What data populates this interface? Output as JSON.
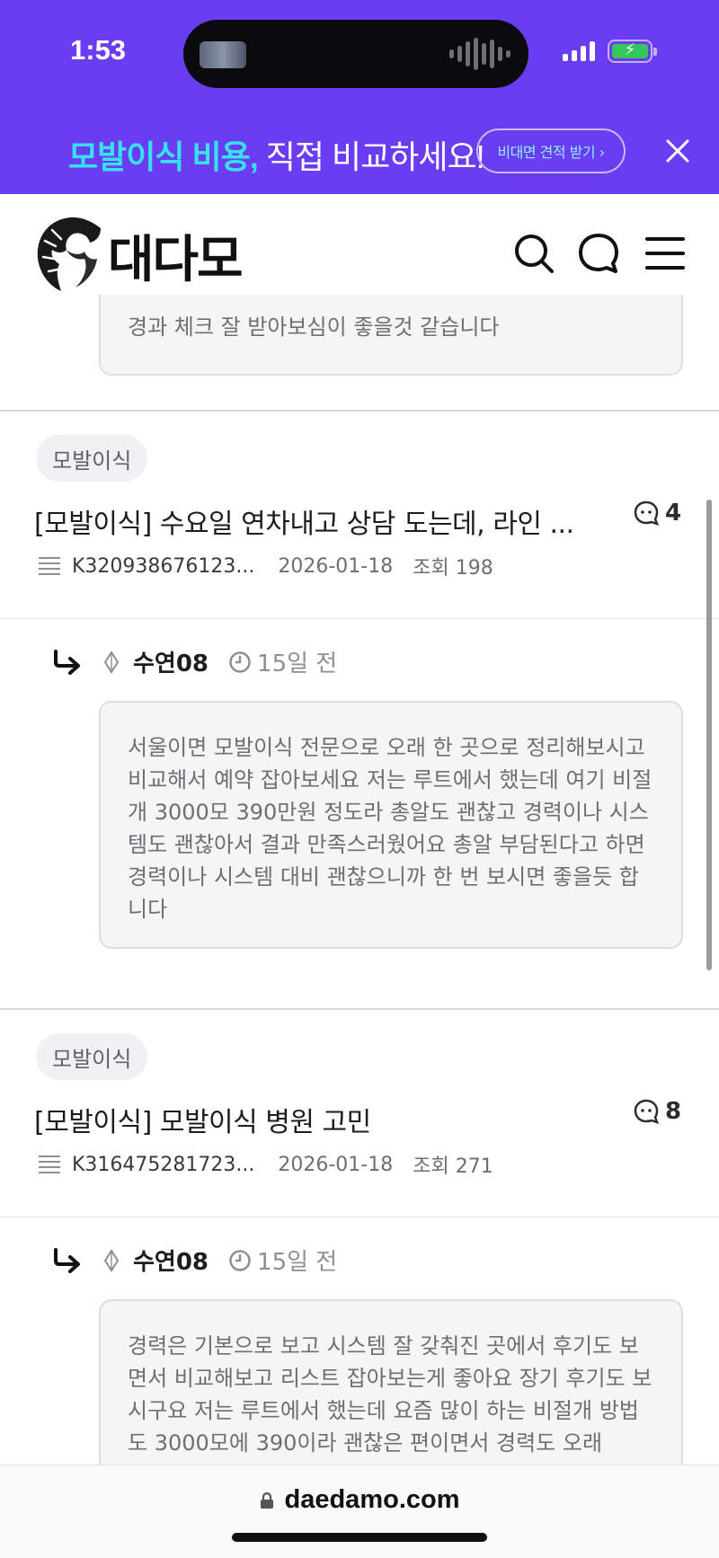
{
  "status_bar": {
    "time": "1:53"
  },
  "ad_banner": {
    "highlight": "모발이식 비용,",
    "rest": " 직접 비교하세요!",
    "button_label": "비대면 견적 받기 ›"
  },
  "header": {
    "logo_text": "대다모"
  },
  "prev_reply_tail": "경과 체크 잘 받아보심이 좋을것 같습니다",
  "posts": [
    {
      "tag": "모발이식",
      "title": "[모발이식] 수요일 연차내고 상담 도는데, 라인 ...",
      "author": "K320938676123...",
      "date": "2026-01-18",
      "views": "조회 198",
      "comment_count": "4",
      "reply": {
        "nickname": "수연08",
        "time_ago": "15일 전",
        "body": "서울이면 모발이식 전문으로 오래 한 곳으로 정리해보시고 비교해서 예약 잡아보세요 저는 루트에서 했는데 여기 비절개 3000모 390만원 정도라 총알도 괜찮고 경력이나 시스템도 괜찮아서 결과 만족스러웠어요 총알 부담된다고 하면 경력이나 시스템 대비 괜찮으니까 한 번 보시면 좋을듯 합니다"
      }
    },
    {
      "tag": "모발이식",
      "title": "[모발이식] 모발이식 병원 고민",
      "author": "K316475281723...",
      "date": "2026-01-18",
      "views": "조회 271",
      "comment_count": "8",
      "reply": {
        "nickname": "수연08",
        "time_ago": "15일 전",
        "body": "경력은 기본으로 보고 시스템 잘 갖춰진 곳에서 후기도 보면서 비교해보고 리스트 잡아보는게 좋아요 장기 후기도 보시구요 저는 루트에서 했는데 요즘 많이 하는 비절개 방법도 3000모에 390이라 괜찮은 편이면서 경력도 오래"
      }
    }
  ],
  "url_bar": {
    "domain": "daedamo.com"
  },
  "colors": {
    "banner_bg": "#6a3df2",
    "banner_highlight": "#36e2f0"
  }
}
